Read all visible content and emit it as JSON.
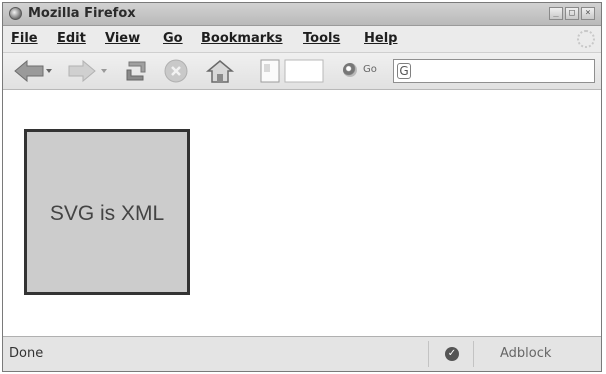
{
  "window": {
    "title": "Mozilla Firefox",
    "controls": [
      "minimize-icon",
      "maximize-icon",
      "close-icon"
    ]
  },
  "menu": {
    "items": [
      {
        "label": "File",
        "accesskey_index": 0
      },
      {
        "label": "Edit",
        "accesskey_index": 0
      },
      {
        "label": "View",
        "accesskey_index": 0
      },
      {
        "label": "Go",
        "accesskey_index": 0
      },
      {
        "label": "Bookmarks",
        "accesskey_index": 0
      },
      {
        "label": "Tools",
        "accesskey_index": 0
      },
      {
        "label": "Help",
        "accesskey_index": 0
      }
    ]
  },
  "toolbar": {
    "buttons": [
      "back-arrow-icon",
      "forward-arrow-icon",
      "reload-icon",
      "stop-icon",
      "home-icon",
      "page-icon"
    ],
    "go_label": "Go",
    "address_value": ""
  },
  "content": {
    "svg_text": "SVG is XML",
    "box_fill": "#cccccc",
    "box_stroke": "#333333"
  },
  "status": {
    "text": "Done",
    "addon": "Adblock"
  }
}
